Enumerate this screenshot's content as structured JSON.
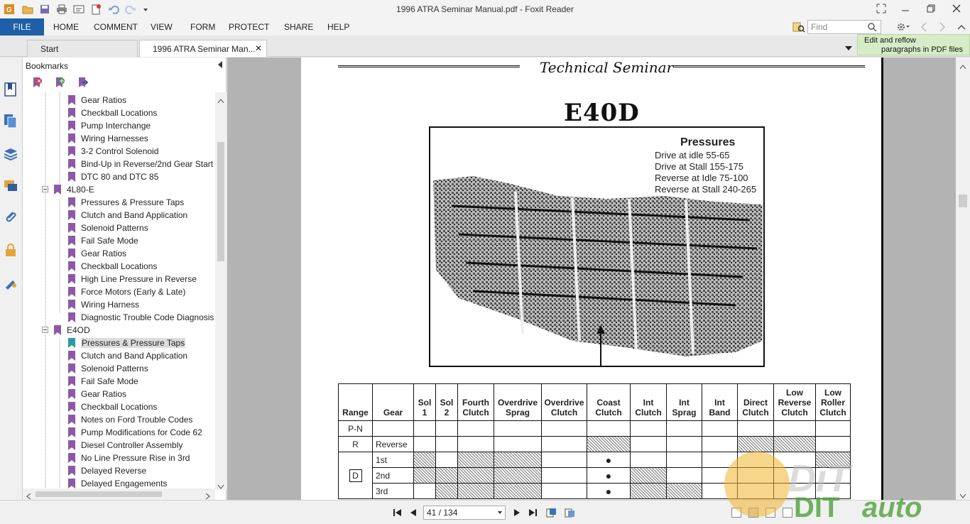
{
  "window": {
    "title": "1996 ATRA Seminar Manual.pdf - Foxit Reader"
  },
  "menu": {
    "file": "FILE",
    "items": [
      "HOME",
      "COMMENT",
      "VIEW",
      "FORM",
      "PROTECT",
      "SHARE",
      "HELP"
    ]
  },
  "search": {
    "placeholder": "Find"
  },
  "tabs": {
    "start": "Start",
    "doc": "1996 ATRA Seminar Man..."
  },
  "tooltip": {
    "line1": "Edit and reflow",
    "line2": "paragraphs in PDF files"
  },
  "bookmarks": {
    "header": "Bookmarks",
    "items": [
      {
        "label": "Gear Ratios",
        "level": 2
      },
      {
        "label": "Checkball Locations",
        "level": 2
      },
      {
        "label": "Pump Interchange",
        "level": 2
      },
      {
        "label": "Wiring Harnesses",
        "level": 2
      },
      {
        "label": "3-2 Control Solenoid",
        "level": 2
      },
      {
        "label": "Bind-Up in Reverse/2nd Gear Start",
        "level": 2
      },
      {
        "label": "DTC 80 and DTC 85",
        "level": 2
      },
      {
        "label": "4L80-E",
        "level": 1
      },
      {
        "label": "Pressures & Pressure Taps",
        "level": 2
      },
      {
        "label": "Clutch and Band Application",
        "level": 2
      },
      {
        "label": "Solenoid Patterns",
        "level": 2
      },
      {
        "label": "Fail Safe Mode",
        "level": 2
      },
      {
        "label": "Gear Ratios",
        "level": 2
      },
      {
        "label": "Checkball Locations",
        "level": 2
      },
      {
        "label": "High Line Pressure in Reverse",
        "level": 2
      },
      {
        "label": "Force Motors (Early & Late)",
        "level": 2
      },
      {
        "label": "Wiring Harness",
        "level": 2
      },
      {
        "label": "Diagnostic Trouble Code Diagnosis",
        "level": 2
      },
      {
        "label": "E4OD",
        "level": 1
      },
      {
        "label": "Pressures & Pressure Taps",
        "level": 2,
        "selected": true
      },
      {
        "label": "Clutch and Band Application",
        "level": 2
      },
      {
        "label": "Solenoid Patterns",
        "level": 2
      },
      {
        "label": "Fail Safe Mode",
        "level": 2
      },
      {
        "label": "Gear Ratios",
        "level": 2
      },
      {
        "label": "Checkball Locations",
        "level": 2
      },
      {
        "label": "Notes on Ford Trouble Codes",
        "level": 2
      },
      {
        "label": "Pump Modifications for Code 62",
        "level": 2
      },
      {
        "label": "Diesel Controller Assembly",
        "level": 2
      },
      {
        "label": "No Line Pressure Rise in 3rd",
        "level": 2
      },
      {
        "label": "Delayed Reverse",
        "level": 2
      },
      {
        "label": "Delayed Engagements",
        "level": 2
      }
    ]
  },
  "page": {
    "header": "Technical Seminar",
    "title": "E40D",
    "pressures": {
      "title": "Pressures",
      "lines": [
        "Drive at idle 55-65",
        "Drive at Stall 155-175",
        "Reverse at Idle 75-100",
        "Reverse at Stall 240-265"
      ]
    },
    "table": {
      "headers": [
        [
          "Range"
        ],
        [
          "Gear"
        ],
        [
          "Sol",
          "1"
        ],
        [
          "Sol",
          "2"
        ],
        [
          "Fourth",
          "Clutch"
        ],
        [
          "Overdrive",
          "Sprag"
        ],
        [
          "Overdrive",
          "Clutch"
        ],
        [
          "Coast",
          "Clutch"
        ],
        [
          "Int",
          "Clutch"
        ],
        [
          "Int",
          "Sprag"
        ],
        [
          "Int",
          "Band"
        ],
        [
          "Direct",
          "Clutch"
        ],
        [
          "Low",
          "Reverse",
          "Clutch"
        ],
        [
          "Low",
          "Roller",
          "Clutch"
        ]
      ],
      "rows": [
        {
          "range": "P-N",
          "gear": ""
        },
        {
          "range": "R",
          "gear": "Reverse"
        },
        {
          "range": "",
          "gear": "1st"
        },
        {
          "range": "D",
          "gear": "2nd"
        },
        {
          "range": "",
          "gear": "3rd"
        }
      ]
    }
  },
  "status": {
    "page_display": "41 / 134"
  },
  "colors": {
    "accent": "#1e5fa8",
    "bookmark_flag": "#8b5aa6",
    "selected_flag": "#2f9aa0"
  }
}
